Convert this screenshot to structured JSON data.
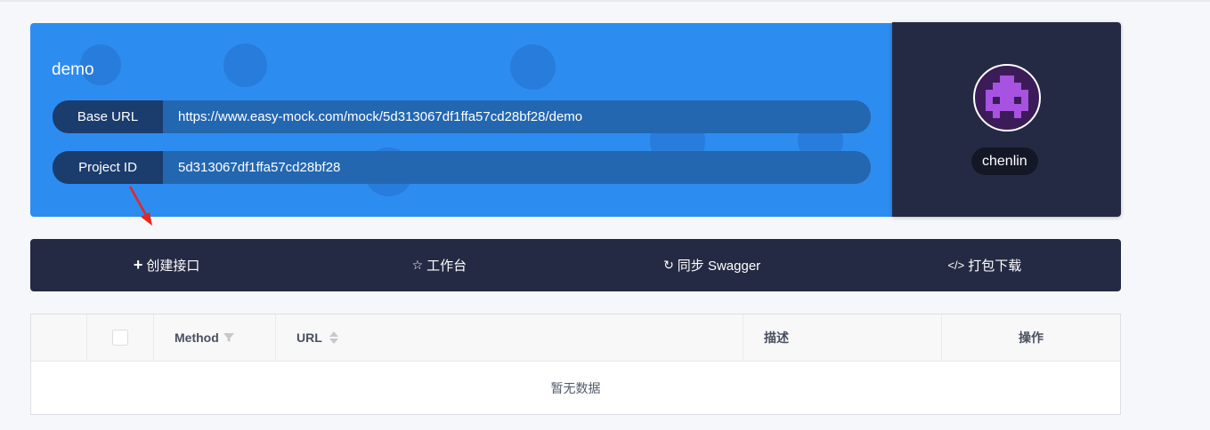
{
  "project": {
    "name": "demo",
    "base_url_label": "Base URL",
    "base_url": "https://www.easy-mock.com/mock/5d313067df1ffa57cd28bf28/demo",
    "project_id_label": "Project ID",
    "project_id": "5d313067df1ffa57cd28bf28"
  },
  "user": {
    "name": "chenlin"
  },
  "toolbar": {
    "create": "创建接口",
    "workbench": "工作台",
    "sync": "同步 Swagger",
    "download": "打包下载"
  },
  "table": {
    "headers": {
      "method": "Method",
      "url": "URL",
      "desc": "描述",
      "action": "操作"
    },
    "empty_text": "暂无数据"
  },
  "colors": {
    "accent": "#2d8cf0",
    "dark": "#252a44",
    "arrow": "#e8261e"
  }
}
